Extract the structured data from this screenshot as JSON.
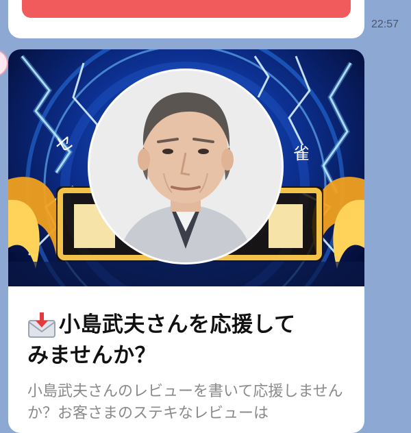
{
  "chat": {
    "previous_message": {
      "time": "22:57"
    },
    "card": {
      "title_line1": "小島武夫さんを応援して",
      "title_line2": "みませんか？",
      "description": "小島武夫さんのレビューを書いて応援しませんか？お客さまのステキなレビューは",
      "banner_text_left": "セ",
      "banner_text_right": "雀",
      "icon": "envelope-with-arrow-icon"
    }
  },
  "colors": {
    "chat_background": "#8ea8d4",
    "button_red": "#f25b5b",
    "card_background": "#ffffff",
    "banner_blue": "#1b5fd6",
    "lightning": "#bfe6ff",
    "gold": "#f0a020"
  }
}
